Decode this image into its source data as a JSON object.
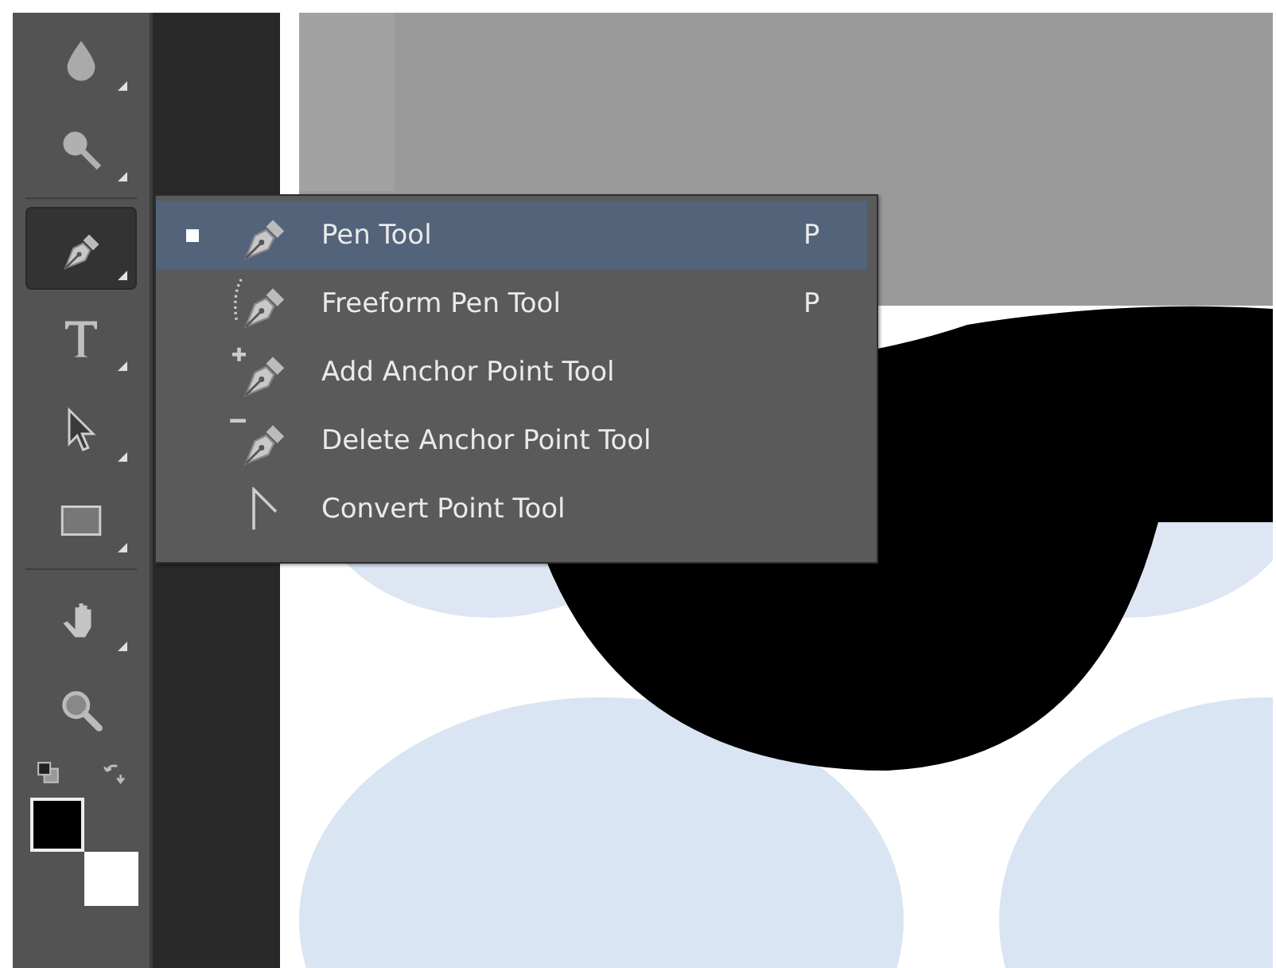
{
  "toolbar": {
    "groups": [
      {
        "tools": [
          {
            "kind": "drop",
            "selected": false,
            "has_submenu": true
          },
          {
            "kind": "smudge",
            "selected": false,
            "has_submenu": true
          }
        ]
      },
      {
        "tools": [
          {
            "kind": "pen",
            "selected": true,
            "has_submenu": true
          },
          {
            "kind": "type",
            "selected": false,
            "has_submenu": true
          },
          {
            "kind": "arrow",
            "selected": false,
            "has_submenu": true
          },
          {
            "kind": "rectangle",
            "selected": false,
            "has_submenu": true
          }
        ]
      },
      {
        "tools": [
          {
            "kind": "hand",
            "selected": false,
            "has_submenu": true
          },
          {
            "kind": "zoom",
            "selected": false,
            "has_submenu": false
          }
        ]
      }
    ],
    "swatches": [
      {
        "color": "#000000"
      },
      {
        "color": "#ffffff"
      }
    ]
  },
  "tool_menu": {
    "items": [
      {
        "kind": "pen",
        "label": "Pen Tool",
        "shortcut": "P",
        "selected": true
      },
      {
        "kind": "freeform",
        "label": "Freeform Pen Tool",
        "shortcut": "P",
        "selected": false
      },
      {
        "kind": "add",
        "label": "Add Anchor Point Tool",
        "selected": false
      },
      {
        "kind": "delete",
        "label": "Delete Anchor Point Tool",
        "selected": false
      },
      {
        "kind": "convert",
        "label": "Convert Point Tool",
        "selected": false
      }
    ]
  }
}
